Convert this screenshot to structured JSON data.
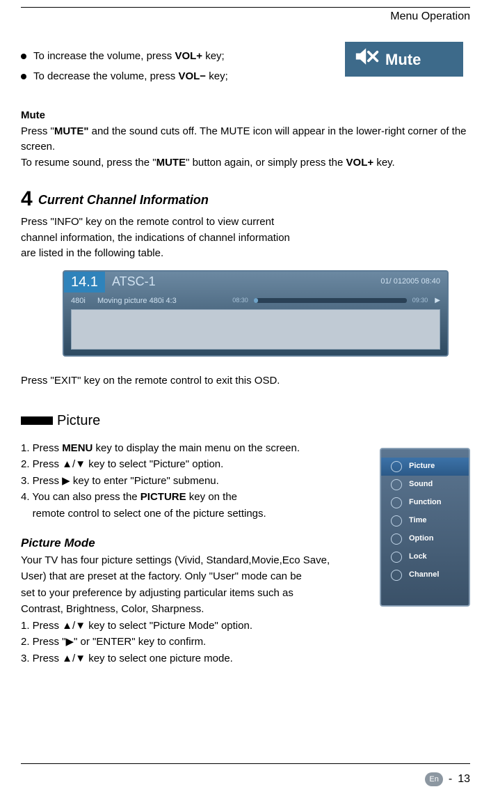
{
  "header": {
    "section_title": "Menu Operation"
  },
  "mute_badge": {
    "label": "Mute"
  },
  "volume": {
    "increase_pre": "To increase the volume, press ",
    "increase_bold": "VOL",
    "increase_suf": " key;",
    "plus": "+",
    "decrease_pre": "To decrease the volume, press ",
    "decrease_bold": "VOL",
    "decrease_suf": " key;",
    "minus": "−"
  },
  "mute": {
    "heading": "Mute",
    "p1a": "Press \"",
    "p1b": "MUTE\"",
    "p1c": " and the sound cuts off. The MUTE icon will appear in the lower-right corner of the screen.",
    "p2a": "To resume sound, press the \"",
    "p2b": "MUTE",
    "p2c": "\" button again, or simply press the ",
    "p2d": "VOL",
    "p2e": " key.",
    "plus": "+"
  },
  "cci": {
    "num": "4",
    "title": "Current Channel Information",
    "text": "Press \"INFO\" key on the remote control to view current channel information, the indications of channel information are listed in the following table.",
    "exit": "Press \"EXIT\" key on the remote control to exit this OSD."
  },
  "osd": {
    "channel_num": "14.1",
    "channel_name": "ATSC-1",
    "datetime": "01/ 012005 08:40",
    "resolution": "480i",
    "desc": "Moving picture 480i 4:3",
    "start": "08:30",
    "end": "09:30",
    "play": "▶"
  },
  "picture_section": {
    "title": "Picture",
    "s1a": "1. Press ",
    "s1b": "MENU",
    "s1c": " key to display the main menu on the screen.",
    "s2": "2. Press ▲/▼ key to select \"Picture\" option.",
    "s3": "3. Press ▶ key to enter \"Picture\" submenu.",
    "s4a": "4. You can also press the ",
    "s4b": "PICTURE",
    "s4c": " key on the",
    "s4d": "    remote control to select one of the picture settings."
  },
  "picture_mode": {
    "title": "Picture Mode",
    "intro1": "Your TV has four picture settings (Vivid, Standard,Movie,Eco Save,",
    "intro2": "User) that are preset at the factory. Only \"User\" mode can be",
    "intro3": "set to your preference by adjusting particular items such as",
    "intro4": "Contrast, Brightness, Color, Sharpness.",
    "s1": "1. Press ▲/▼ key to select \"Picture Mode\" option.",
    "s2": "2. Press \"▶\" or \"ENTER\" key to confirm.",
    "s3": "3. Press ▲/▼ key to select one picture mode."
  },
  "menu": {
    "items": [
      "Picture",
      "Sound",
      "Function",
      "Time",
      "Option",
      "Lock",
      "Channel"
    ]
  },
  "footer": {
    "lang": "En",
    "dash": "-",
    "page": "13"
  }
}
